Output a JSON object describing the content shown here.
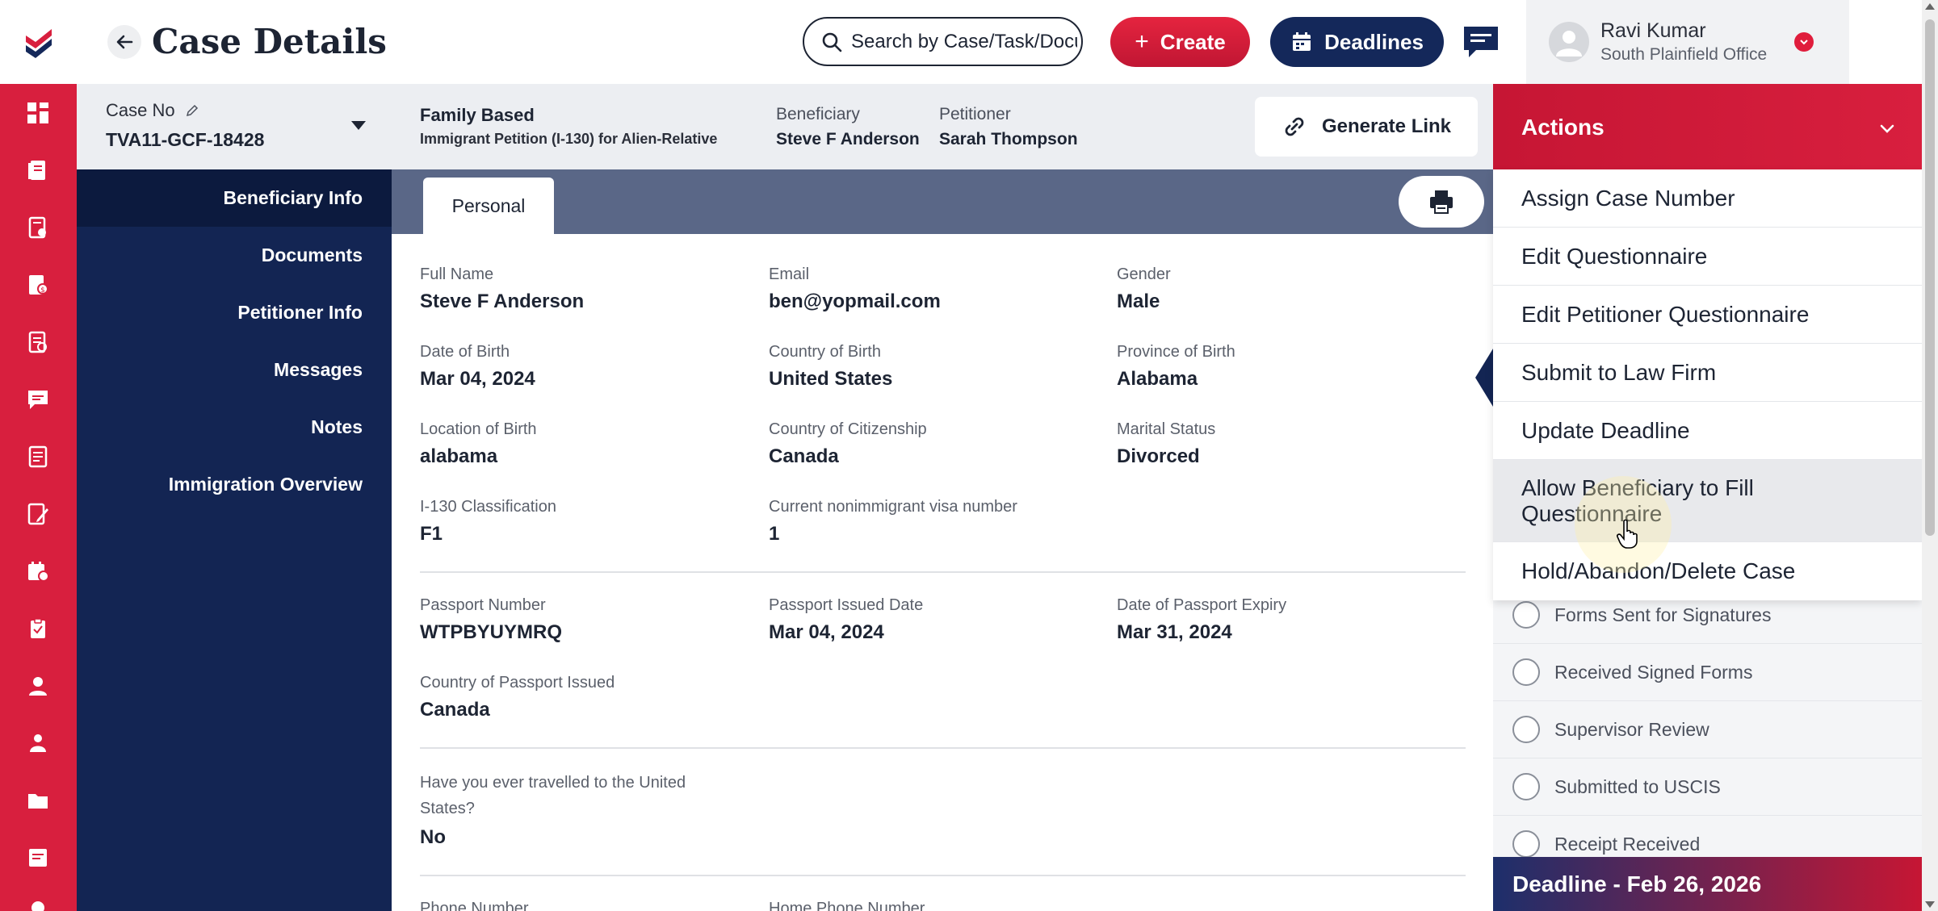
{
  "header": {
    "title": "Case Details",
    "search_placeholder": "Search by Case/Task/Document",
    "create_label": "Create",
    "deadlines_label": "Deadlines"
  },
  "user": {
    "name": "Ravi Kumar",
    "office": "South Plainfield Office"
  },
  "case": {
    "number_label": "Case No",
    "number": "TVA11-GCF-18428",
    "type": "Family Based",
    "type_sub": "Immigrant Petition (I-130) for Alien-Relative",
    "beneficiary_label": "Beneficiary",
    "beneficiary": "Steve F Anderson",
    "petitioner_label": "Petitioner",
    "petitioner": "Sarah Thompson",
    "generate_link_label": "Generate Link"
  },
  "nav": {
    "items": [
      {
        "label": "Beneficiary Info"
      },
      {
        "label": "Documents"
      },
      {
        "label": "Petitioner Info"
      },
      {
        "label": "Messages"
      },
      {
        "label": "Notes"
      },
      {
        "label": "Immigration Overview"
      }
    ]
  },
  "tabs": {
    "personal": "Personal"
  },
  "personal": {
    "full_name_label": "Full Name",
    "full_name": "Steve F Anderson",
    "email_label": "Email",
    "email": "ben@yopmail.com",
    "gender_label": "Gender",
    "gender": "Male",
    "dob_label": "Date of Birth",
    "dob": "Mar 04, 2024",
    "cob_label": "Country of Birth",
    "cob": "United States",
    "pob_label": "Province of Birth",
    "pob": "Alabama",
    "lob_label": "Location of Birth",
    "lob": "alabama",
    "citizenship_label": "Country of Citizenship",
    "citizenship": "Canada",
    "marital_label": "Marital Status",
    "marital": "Divorced",
    "classification_label": "I-130 Classification",
    "classification": "F1",
    "visa_label": "Current nonimmigrant visa number",
    "visa": "1",
    "passport_no_label": "Passport Number",
    "passport_no": "WTPBYUYMRQ",
    "passport_issued_label": "Passport Issued Date",
    "passport_issued": "Mar 04, 2024",
    "passport_expiry_label": "Date of Passport Expiry",
    "passport_expiry": "Mar 31, 2024",
    "passport_country_label": "Country of Passport Issued",
    "passport_country": "Canada",
    "travel_label": "Have you ever travelled to the United States?",
    "travel": "No",
    "phone_label": "Phone Number",
    "home_phone_label": "Home Phone Number"
  },
  "actions": {
    "title": "Actions",
    "menu": [
      {
        "label": "Assign Case Number"
      },
      {
        "label": "Edit Questionnaire"
      },
      {
        "label": "Edit Petitioner Questionnaire"
      },
      {
        "label": "Submit to Law Firm"
      },
      {
        "label": "Update Deadline"
      },
      {
        "label": "Allow Beneficiary to Fill Questionnaire"
      },
      {
        "label": "Hold/Abandon/Delete Case"
      }
    ],
    "statuses": [
      {
        "label": "Forms Sent for Signatures"
      },
      {
        "label": "Received Signed Forms"
      },
      {
        "label": "Supervisor Review"
      },
      {
        "label": "Submitted to USCIS"
      },
      {
        "label": "Receipt Received"
      }
    ],
    "deadline": "Deadline - Feb 26, 2026"
  },
  "colors": {
    "brand_red": "#d81f3e",
    "navy": "#14285a",
    "nav_bg": "#132553"
  }
}
